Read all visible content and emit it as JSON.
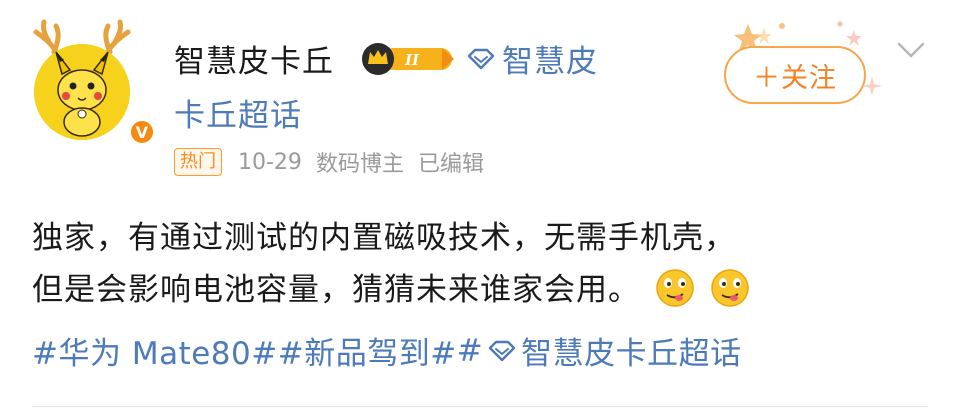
{
  "post": {
    "author": "智慧皮卡丘",
    "badge_level": "II",
    "supertopic_line1": "智慧皮",
    "supertopic_line2": "卡丘超话",
    "hot_tag": "热门",
    "date": "10-29",
    "author_role": "数码博主",
    "edited": "已编辑",
    "follow_label": "＋关注",
    "content_line1": "独家，有通过测试的内置磁吸技术，无需手机壳，",
    "content_line2": "但是会影响电池容量，猜猜未来谁家会用。",
    "tag1": "#华为 Mate80#",
    "tag2": "#新品驾到#",
    "tag3": "智慧皮卡丘超话"
  },
  "colors": {
    "link": "#4d7ab8",
    "accent_orange": "#f48222",
    "avatar_yellow": "#f6d21c"
  },
  "icons": [
    "avatar-pikachu",
    "verified-badge-icon",
    "crown-badge-icon",
    "diamond-icon",
    "chevron-down-icon",
    "drooling-emoji"
  ]
}
